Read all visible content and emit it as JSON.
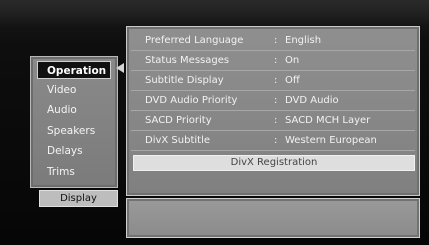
{
  "menu": {
    "items": [
      {
        "label": "Operation",
        "selected": true
      },
      {
        "label": "Video",
        "selected": false
      },
      {
        "label": "Audio",
        "selected": false
      },
      {
        "label": "Speakers",
        "selected": false
      },
      {
        "label": "Delays",
        "selected": false
      },
      {
        "label": "Trims",
        "selected": false
      }
    ],
    "display_button": "Display"
  },
  "settings": {
    "rows": [
      {
        "label": "Preferred Language",
        "separator": ":",
        "value": "English"
      },
      {
        "label": "Status Messages",
        "separator": ":",
        "value": "On"
      },
      {
        "label": "Subtitle Display",
        "separator": ":",
        "value": "Off"
      },
      {
        "label": "DVD Audio Priority",
        "separator": ":",
        "value": "DVD Audio"
      },
      {
        "label": "SACD Priority",
        "separator": ":",
        "value": "SACD MCH Layer"
      },
      {
        "label": "DivX Subtitle",
        "separator": ":",
        "value": "Western European"
      }
    ],
    "action_button": "DivX Registration"
  },
  "info": {
    "text": ""
  }
}
